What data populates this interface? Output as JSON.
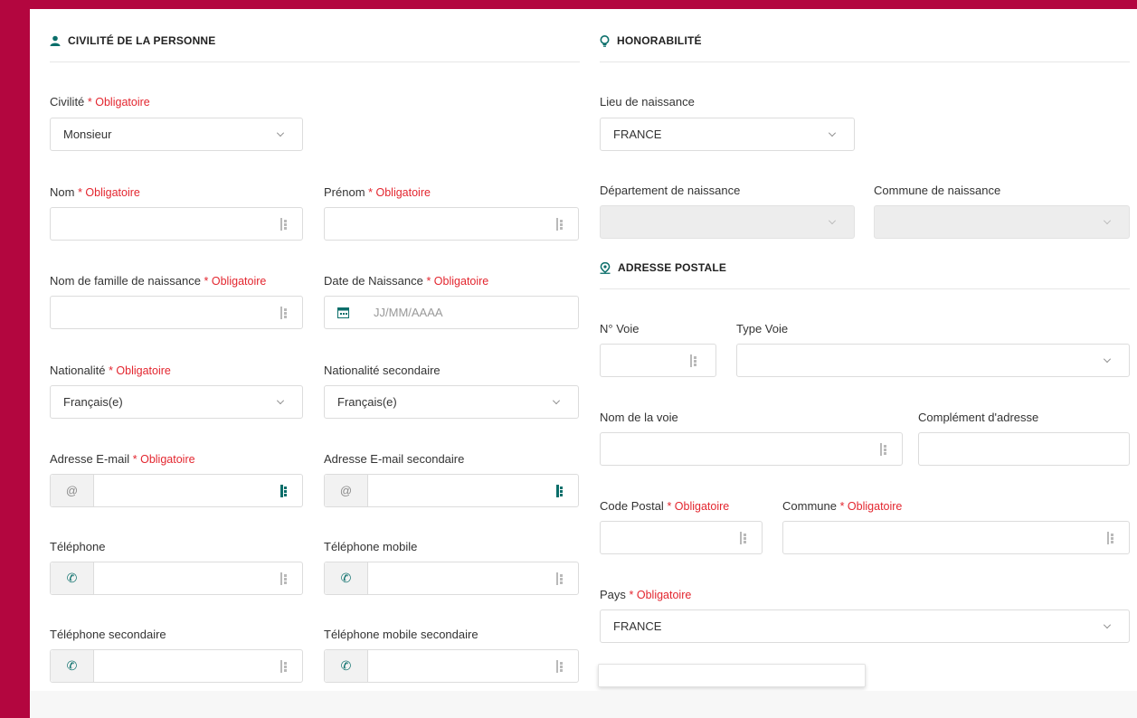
{
  "colors": {
    "brand": "#b3063f",
    "accent": "#0a6e6a",
    "required": "#e3262f"
  },
  "civilite": {
    "title": "CIVILITÉ DE LA PERSONNE",
    "icon": "person-icon",
    "civilite_label": "Civilité",
    "civilite_value": "Monsieur",
    "nom_label": "Nom",
    "prenom_label": "Prénom",
    "nom_famille_label": "Nom de famille de naissance",
    "date_label": "Date de Naissance",
    "date_placeholder": "JJ/MM/AAAA",
    "nationalite_label": "Nationalité",
    "nationalite_value": "Français(e)",
    "nationalite2_label": "Nationalité secondaire",
    "nationalite2_value": "Français(e)",
    "email_label": "Adresse E-mail",
    "email2_label": "Adresse E-mail secondaire",
    "email_addon": "@",
    "tel_label": "Téléphone",
    "tel_mobile_label": "Téléphone mobile",
    "tel2_label": "Téléphone secondaire",
    "tel_mobile2_label": "Téléphone mobile secondaire"
  },
  "honorabilite": {
    "title": "HONORABILITÉ",
    "icon": "lightbulb-icon",
    "lieu_label": "Lieu de naissance",
    "lieu_value": "FRANCE",
    "dept_label": "Département de naissance",
    "commune_label": "Commune de naissance"
  },
  "adresse": {
    "title": "ADRESSE POSTALE",
    "icon": "location-pin-icon",
    "num_voie_label": "N° Voie",
    "type_voie_label": "Type Voie",
    "nom_voie_label": "Nom de la voie",
    "complement_label": "Complément d'adresse",
    "code_postal_label": "Code Postal",
    "commune_label": "Commune",
    "pays_label": "Pays",
    "pays_value": "FRANCE"
  },
  "required_text": "* Obligatoire"
}
